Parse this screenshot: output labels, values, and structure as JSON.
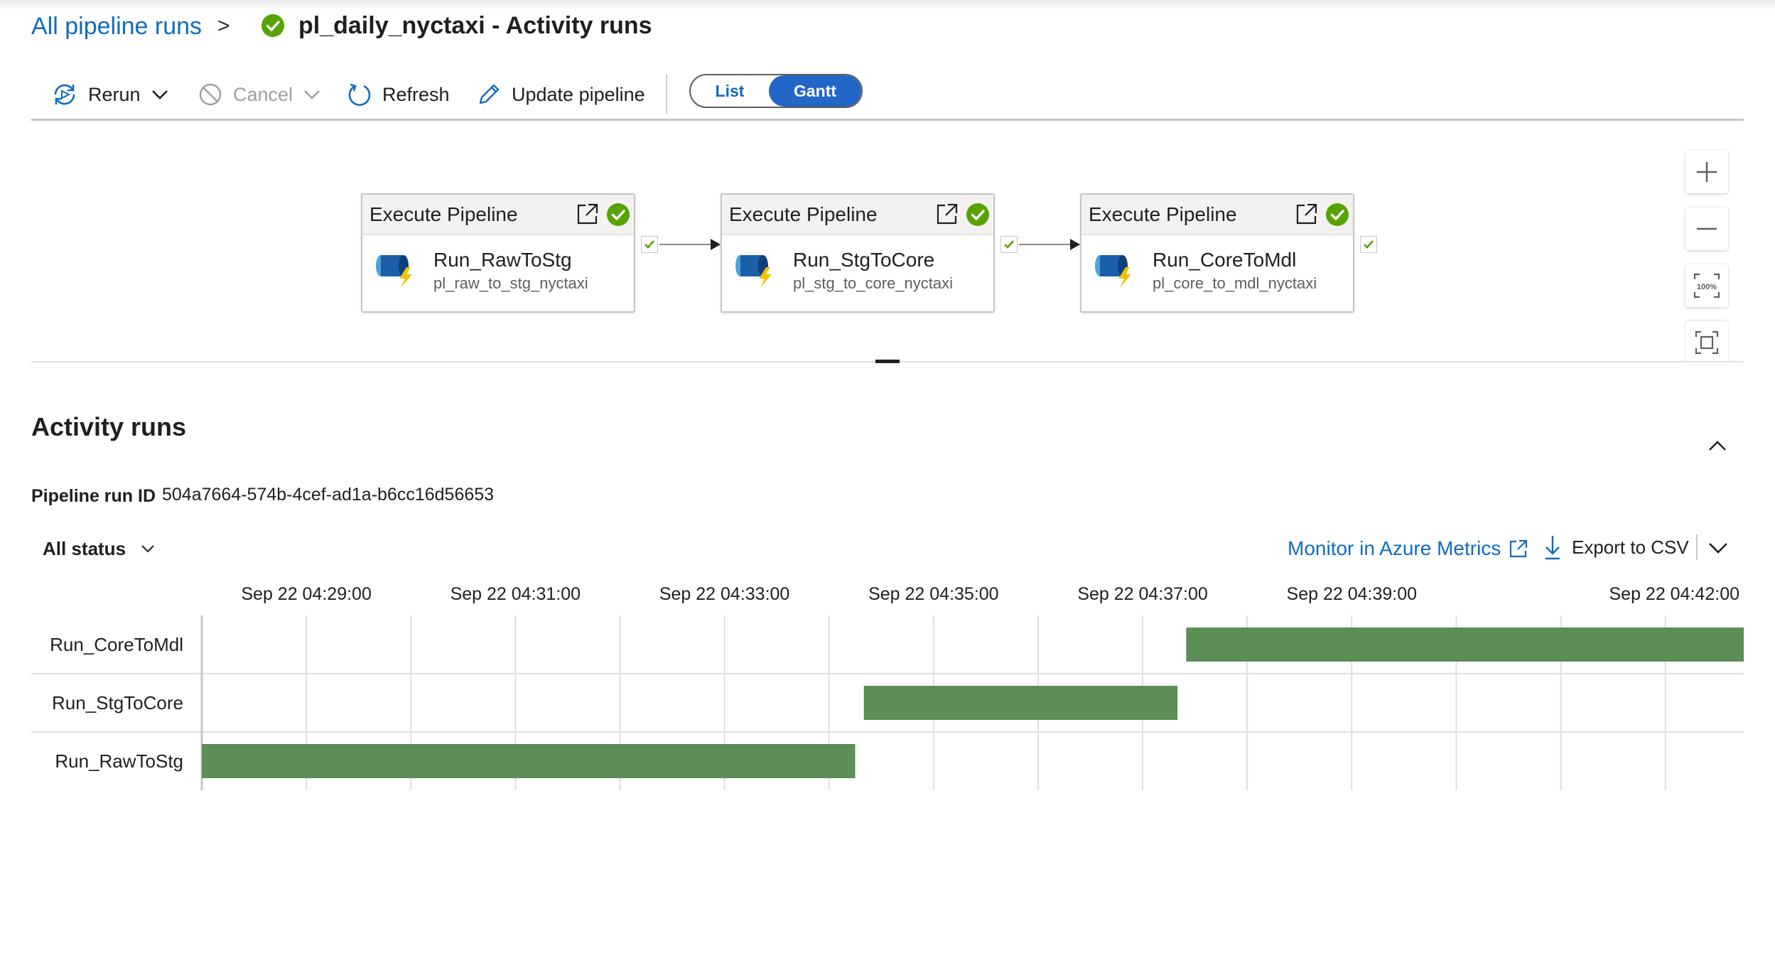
{
  "breadcrumb": {
    "parent_label": "All pipeline runs",
    "separator": ">",
    "title": "pl_daily_nyctaxi - Activity runs",
    "status_icon": "success-check-icon"
  },
  "toolbar": {
    "rerun_label": "Rerun",
    "cancel_label": "Cancel",
    "refresh_label": "Refresh",
    "update_label": "Update pipeline",
    "view_toggle": {
      "list_label": "List",
      "gantt_label": "Gantt",
      "selected": "Gantt"
    }
  },
  "canvas": {
    "zoom_controls": [
      "zoom-in-icon",
      "zoom-out-icon",
      "zoom-100-icon",
      "fit-to-screen-icon"
    ],
    "zoom_100_label": "100%",
    "activities": [
      {
        "type": "Execute Pipeline",
        "name": "Run_RawToStg",
        "pipeline": "pl_raw_to_stg_nyctaxi",
        "status": "Succeeded"
      },
      {
        "type": "Execute Pipeline",
        "name": "Run_StgToCore",
        "pipeline": "pl_stg_to_core_nyctaxi",
        "status": "Succeeded"
      },
      {
        "type": "Execute Pipeline",
        "name": "Run_CoreToMdl",
        "pipeline": "pl_core_to_mdl_nyctaxi",
        "status": "Succeeded"
      }
    ]
  },
  "activity_runs": {
    "title": "Activity runs",
    "run_id_label": "Pipeline run ID",
    "run_id": "504a7664-574b-4cef-ad1a-b6cc16d56653",
    "status_filter": "All status",
    "monitor_label": "Monitor in Azure Metrics",
    "export_label": "Export to CSV"
  },
  "colors": {
    "accent": "#0f6cbd",
    "toggle_selected": "#2266c7",
    "success": "#57a300",
    "bar": "#5b8f55",
    "gridline": "#e1dfdd"
  },
  "chart_data": {
    "type": "gantt",
    "x_axis": {
      "tick_labels": [
        "Sep 22 04:29:00",
        "Sep 22 04:31:00",
        "Sep 22 04:33:00",
        "Sep 22 04:35:00",
        "Sep 22 04:37:00",
        "Sep 22 04:39:00",
        "Sep 22 04:42:00"
      ],
      "tick_times": [
        "04:29:00",
        "04:31:00",
        "04:33:00",
        "04:35:00",
        "04:37:00",
        "04:39:00",
        "04:42:00"
      ],
      "range": [
        "04:28:00",
        "04:42:45"
      ],
      "grid_interval_minutes": 1
    },
    "rows": [
      {
        "name": "Run_CoreToMdl",
        "start": "04:37:25",
        "end": "04:42:45"
      },
      {
        "name": "Run_StgToCore",
        "start": "04:34:20",
        "end": "04:37:20"
      },
      {
        "name": "Run_RawToStg",
        "start": "04:28:00",
        "end": "04:34:15"
      }
    ],
    "grid": true
  }
}
